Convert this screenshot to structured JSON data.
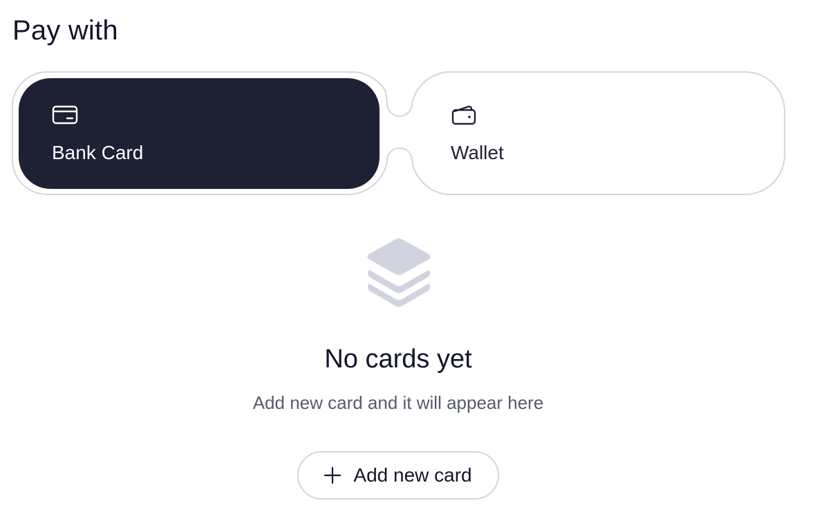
{
  "header": {
    "title": "Pay with"
  },
  "payment_methods": {
    "items": [
      {
        "label": "Bank Card",
        "icon": "card-icon",
        "selected": true
      },
      {
        "label": "Wallet",
        "icon": "wallet-icon",
        "selected": false
      }
    ]
  },
  "empty_state": {
    "icon": "stack-icon",
    "title": "No cards yet",
    "subtitle": "Add new card and it will appear here",
    "button_label": "Add new card",
    "button_icon": "plus-icon"
  },
  "colors": {
    "selected_bg": "#1e2034",
    "text_primary": "#12142b",
    "text_secondary": "#565a6e",
    "border": "#d4d5de",
    "empty_icon": "#d2d3e1"
  }
}
